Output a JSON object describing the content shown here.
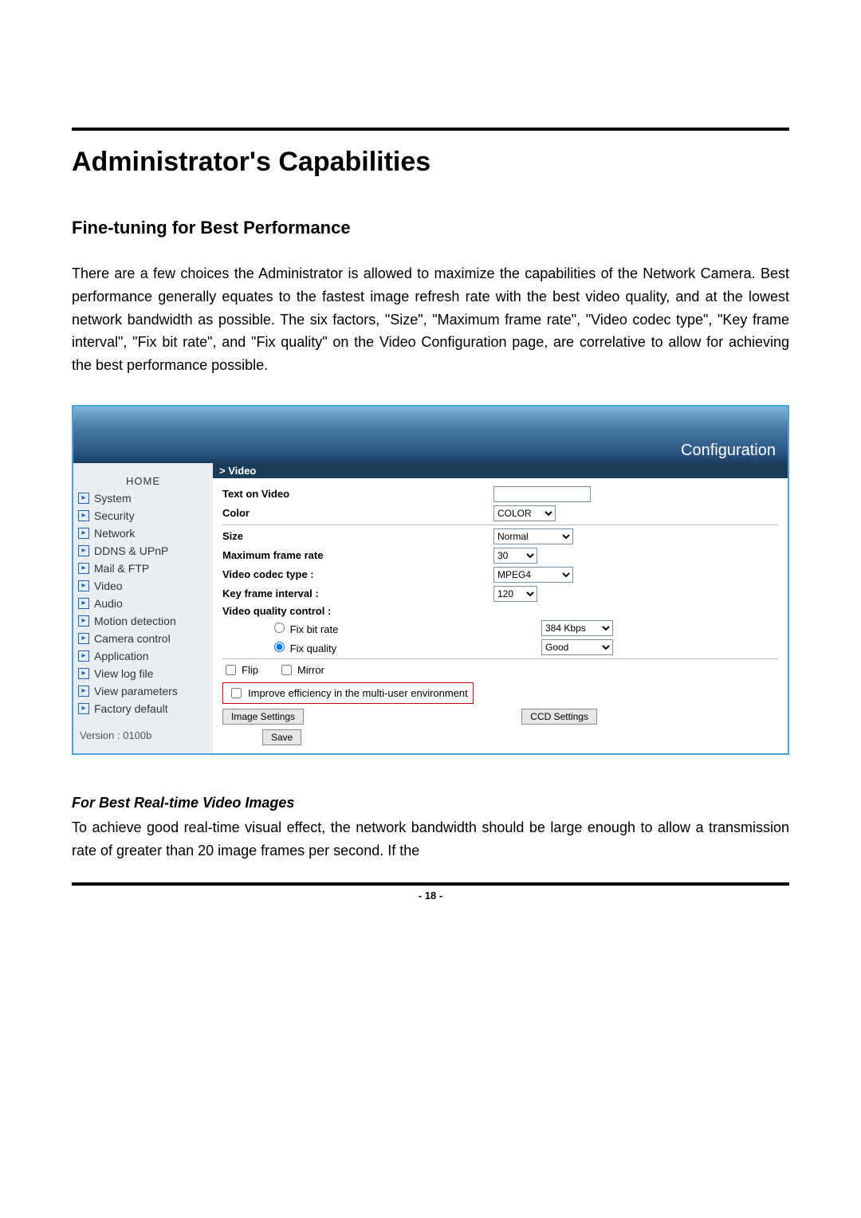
{
  "heading": "Administrator's Capabilities",
  "subheading": "Fine-tuning for Best Performance",
  "intro": "There are a few choices the Administrator is allowed to maximize the capabilities of the Network Camera. Best performance generally equates to the fastest image refresh rate with the best video quality, and at the lowest network bandwidth as possible. The six factors, \"Size\", \"Maximum frame rate\", \"Video codec type\", \"Key frame interval\", \"Fix bit rate\", and \"Fix quality\" on the Video Configuration page, are correlative to allow for achieving the best performance possible.",
  "config_title": "Configuration",
  "sidebar": {
    "home": "HOME",
    "items": [
      "System",
      "Security",
      "Network",
      "DDNS & UPnP",
      "Mail & FTP",
      "Video",
      "Audio",
      "Motion detection",
      "Camera control",
      "Application",
      "View log file",
      "View parameters",
      "Factory default"
    ],
    "version": "Version : 0100b"
  },
  "panel": {
    "header": "> Video",
    "text_on_video": "Text on Video",
    "color_label": "Color",
    "color_value": "COLOR",
    "size_label": "Size",
    "size_value": "Normal",
    "maxfr_label": "Maximum frame rate",
    "maxfr_value": "30",
    "codec_label": "Video codec type :",
    "codec_value": "MPEG4",
    "keyframe_label": "Key frame interval :",
    "keyframe_value": "120",
    "vqc_label": "Video quality control :",
    "fixbitrate_label": "Fix bit rate",
    "fixbitrate_value": "384 Kbps",
    "fixquality_label": "Fix quality",
    "fixquality_value": "Good",
    "flip": "Flip",
    "mirror": "Mirror",
    "improve": "Improve efficiency in the multi-user environment",
    "image_settings": "Image Settings",
    "ccd_settings": "CCD Settings",
    "save": "Save"
  },
  "section3_heading": "For Best Real-time Video Images",
  "section3_body": "To achieve good real-time visual effect, the network bandwidth should be large enough to allow a transmission rate of greater than 20 image frames per second.  If the",
  "page_number": "- 18 -"
}
